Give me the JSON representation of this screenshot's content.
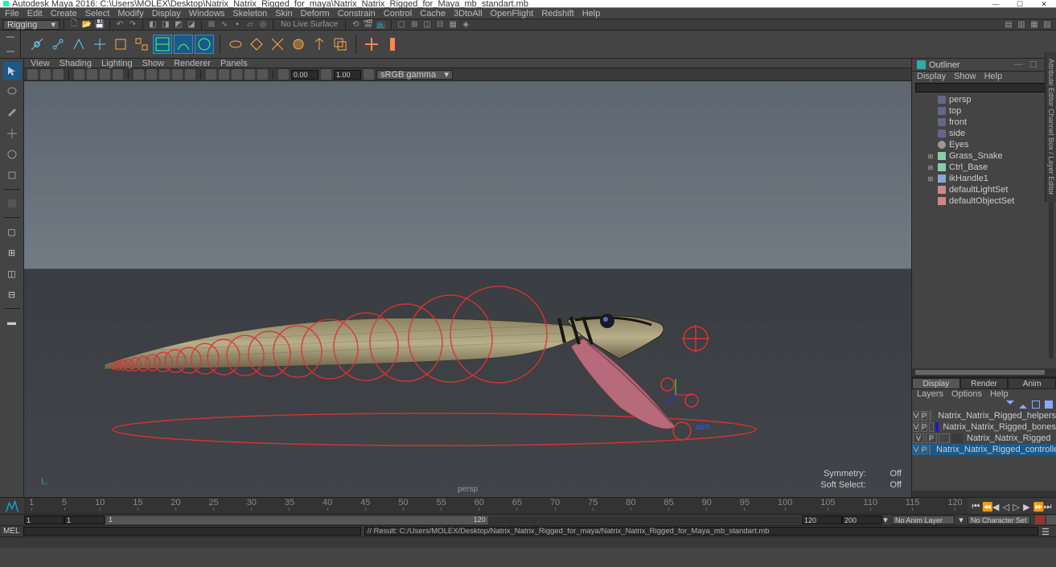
{
  "titlebar": {
    "text": "Autodesk Maya 2016: C:\\Users\\MOLEX\\Desktop\\Natrix_Natrix_Rigged_for_maya\\Natrix_Natrix_Rigged_for_Maya_mb_standart.mb"
  },
  "menubar": [
    "File",
    "Edit",
    "Create",
    "Select",
    "Modify",
    "Display",
    "Windows",
    "Skeleton",
    "Skin",
    "Deform",
    "Constrain",
    "Control",
    "Cache",
    "3DtoAll",
    "OpenFlight",
    "Redshift",
    "Help"
  ],
  "mode_dropdown": "Rigging",
  "no_live_surface": "No Live Surface",
  "viewport_menus": [
    "View",
    "Shading",
    "Lighting",
    "Show",
    "Renderer",
    "Panels"
  ],
  "exposure": "0.00",
  "gamma": "1.00",
  "colorspace": "sRGB gamma",
  "viewport_label": "persp",
  "viewport_status": {
    "symmetry_label": "Symmetry:",
    "symmetry_value": "Off",
    "softsel_label": "Soft Select:",
    "softsel_value": "Off"
  },
  "outliner": {
    "title": "Outliner",
    "menus": [
      "Display",
      "Show",
      "Help"
    ],
    "items": [
      {
        "name": "persp",
        "type": "cam",
        "exp": false
      },
      {
        "name": "top",
        "type": "cam",
        "exp": false
      },
      {
        "name": "front",
        "type": "cam",
        "exp": false
      },
      {
        "name": "side",
        "type": "cam",
        "exp": false
      },
      {
        "name": "Eyes",
        "type": "mesh",
        "exp": false
      },
      {
        "name": "Grass_Snake",
        "type": "xform",
        "exp": true
      },
      {
        "name": "Ctrl_Base",
        "type": "xform",
        "exp": true
      },
      {
        "name": "ikHandle1",
        "type": "ik",
        "exp": true
      },
      {
        "name": "defaultLightSet",
        "type": "set",
        "exp": false
      },
      {
        "name": "defaultObjectSet",
        "type": "set",
        "exp": false
      }
    ]
  },
  "dra": {
    "tabs": [
      "Display",
      "Render",
      "Anim"
    ],
    "active_tab": 0,
    "menus": [
      "Layers",
      "Options",
      "Help"
    ],
    "layers": [
      {
        "v": "V",
        "p": "P",
        "color": "#1a6a1a",
        "name": "Natrix_Natrix_Rigged_helpers",
        "sel": false
      },
      {
        "v": "V",
        "p": "P",
        "color": "#1a1aca",
        "name": "Natrix_Natrix_Rigged_bones",
        "sel": false
      },
      {
        "v": "V",
        "p": "P",
        "color": "#3a3a3a",
        "name": "Natrix_Natrix_Rigged",
        "sel": false
      },
      {
        "v": "V",
        "p": "P",
        "color": "#ca1a4a",
        "name": "Natrix_Natrix_Rigged_controllers",
        "sel": true
      }
    ]
  },
  "timeline": {
    "ticks": [
      "1",
      "5",
      "10",
      "15",
      "20",
      "25",
      "30",
      "35",
      "40",
      "45",
      "50",
      "55",
      "60",
      "65",
      "70",
      "75",
      "80",
      "85",
      "90",
      "95",
      "100",
      "105",
      "110",
      "115",
      "120"
    ]
  },
  "range": {
    "start_outer": "1",
    "start_inner": "1",
    "end_inner": "120",
    "end_outer": "120",
    "frame": "200",
    "animlayer": "No Anim Layer",
    "charset": "No Character Set"
  },
  "cmd": {
    "lang": "MEL",
    "result": "// Result: C:/Users/MOLEX/Desktop/Natrix_Natrix_Rigged_for_maya/Natrix_Natrix_Rigged_for_Maya_mb_standart.mb"
  },
  "helpline": " ",
  "side_tabs": "Attribute Editor  Channel Box / Layer Editor"
}
